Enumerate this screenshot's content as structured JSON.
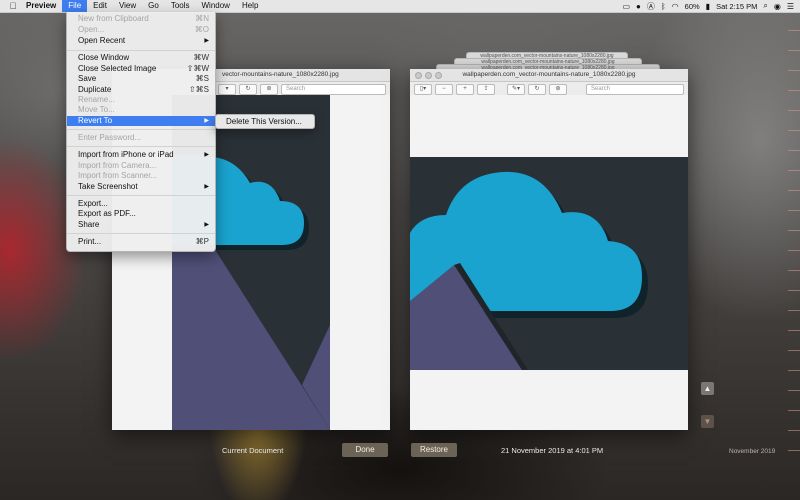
{
  "menubar": {
    "apple_icon": "apple-icon",
    "items": [
      "Preview",
      "File",
      "Edit",
      "View",
      "Go",
      "Tools",
      "Window",
      "Help"
    ],
    "active": "File",
    "battery": "60%",
    "clock": "Sat 2:15 PM"
  },
  "file_menu": {
    "items": [
      {
        "label": "New from Clipboard",
        "shortcut": "⌘N",
        "disabled": true
      },
      {
        "label": "Open...",
        "shortcut": "⌘O",
        "disabled": true
      },
      {
        "label": "Open Recent",
        "submenu": true
      },
      {
        "label": "Close Window",
        "shortcut": "⌘W"
      },
      {
        "label": "Close Selected Image",
        "shortcut": "⇧⌘W"
      },
      {
        "label": "Save",
        "shortcut": "⌘S"
      },
      {
        "label": "Duplicate",
        "shortcut": "⇧⌘S"
      },
      {
        "label": "Rename...",
        "disabled": true
      },
      {
        "label": "Move To...",
        "disabled": true
      },
      {
        "label": "Revert To",
        "submenu": true,
        "highlighted": true
      },
      {
        "label": "Enter Password...",
        "disabled": true
      },
      {
        "label": "Import from iPhone or iPad",
        "submenu": true
      },
      {
        "label": "Import from Camera...",
        "disabled": true
      },
      {
        "label": "Import from Scanner...",
        "disabled": true
      },
      {
        "label": "Take Screenshot",
        "submenu": true
      },
      {
        "label": "Export..."
      },
      {
        "label": "Export as PDF..."
      },
      {
        "label": "Share",
        "submenu": true
      },
      {
        "label": "Print...",
        "shortcut": "⌘P"
      }
    ],
    "revert_submenu": [
      "Delete This Version..."
    ]
  },
  "left_window": {
    "title": "vector-mountains-nature_1080x2280.jpg",
    "search_placeholder": "Search"
  },
  "right_window": {
    "title": "wallpaperden.com_vector-mountains-nature_1080x2280.jpg",
    "search_placeholder": "Search"
  },
  "version_stack_titles": [
    "wallpaperden.com_vector-mountains-nature_1080x2280.jpg",
    "wallpaperden.com_vector-mountains-nature_1080x2280.jpg",
    "wallpaperden.com_vector-mountains-nature_1080x2280.jpg"
  ],
  "bottom": {
    "current_label": "Current Document",
    "done_label": "Done",
    "restore_label": "Restore",
    "version_date": "21 November 2019 at 4:01 PM",
    "timeline_label": "November 2019"
  },
  "colors": {
    "accent": "#3f7ef0",
    "cloud": "#1aa3cf",
    "sky": "#2a3136",
    "mountain": "#4f4f78"
  }
}
